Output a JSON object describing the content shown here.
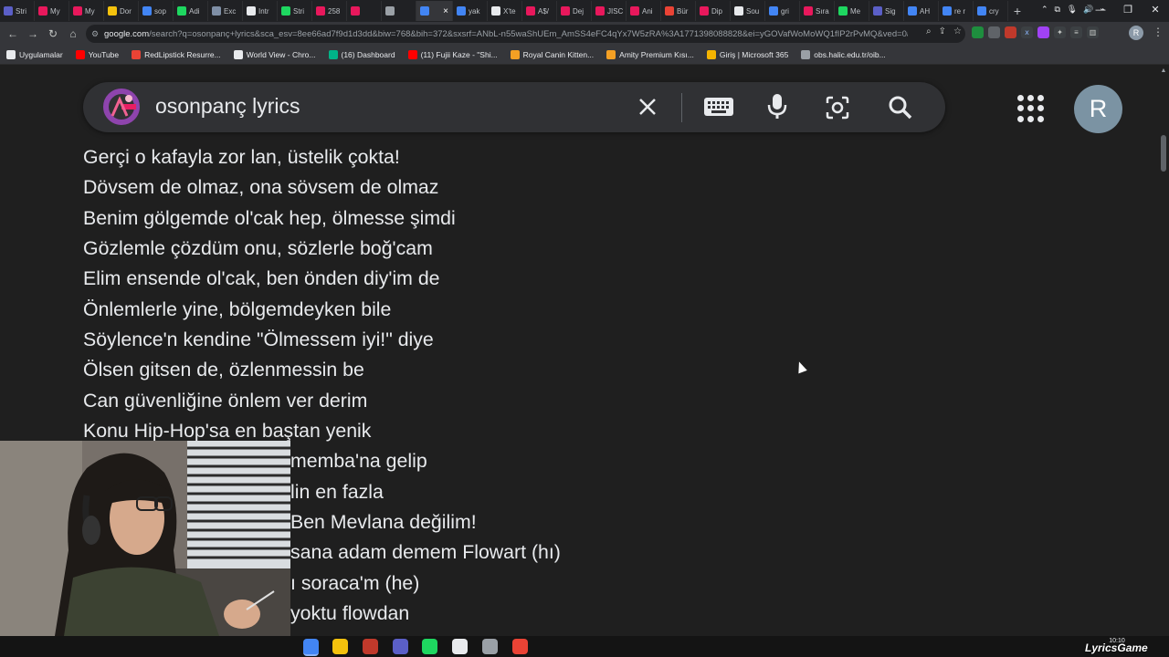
{
  "browser": {
    "tabs": [
      {
        "label": "Stri",
        "color": "#5b5fc7"
      },
      {
        "label": "My",
        "color": "#e8185c"
      },
      {
        "label": "My",
        "color": "#e8185c"
      },
      {
        "label": "Dor",
        "color": "#f4c20d"
      },
      {
        "label": "sop",
        "color": "#4285f4"
      },
      {
        "label": "Adi",
        "color": "#1ed760"
      },
      {
        "label": "Exc",
        "color": "#7f8fa6"
      },
      {
        "label": "Intr",
        "color": "#e8eaed"
      },
      {
        "label": "Stri",
        "color": "#1ed760"
      },
      {
        "label": "258",
        "color": "#e8185c"
      },
      {
        "label": "",
        "color": "#e8185c"
      },
      {
        "label": "",
        "color": "#9aa0a6"
      },
      {
        "label": "",
        "color": "#4285f4"
      },
      {
        "label": "yak",
        "color": "#4285f4"
      },
      {
        "label": "X'te",
        "color": "#e8eaed"
      },
      {
        "label": "A$/",
        "color": "#e8185c"
      },
      {
        "label": "Dej",
        "color": "#e8185c"
      },
      {
        "label": "JISC",
        "color": "#e8185c"
      },
      {
        "label": "Ani",
        "color": "#e8185c"
      },
      {
        "label": "Bür",
        "color": "#ea4335"
      },
      {
        "label": "Dip",
        "color": "#e8185c"
      },
      {
        "label": "Sou",
        "color": "#e8eaed"
      },
      {
        "label": "gri",
        "color": "#4285f4"
      },
      {
        "label": "Sıra",
        "color": "#e8185c"
      },
      {
        "label": "Me",
        "color": "#1ed760"
      },
      {
        "label": "Sig",
        "color": "#5b5fc7"
      },
      {
        "label": "AH",
        "color": "#4285f4"
      },
      {
        "label": "re r",
        "color": "#4285f4"
      },
      {
        "label": "cry",
        "color": "#4285f4"
      }
    ],
    "active_tab_index": 12,
    "new_tab": "+",
    "url_host": "google.com",
    "url_rest": "/search?q=osonpanç+lyrics&sca_esv=8ee66ad7f9d1d3dd&biw=768&bih=372&sxsrf=ANbL-n55waShUEm_AmSS4eFC4qYx7W5zRA%3A1771398088828&ei=yGOVafWoMoWQ1fIP2rPvMQ&ved=0ahU...",
    "bookmarks": [
      {
        "label": "Uygulamalar",
        "color": "#e8eaed"
      },
      {
        "label": "YouTube",
        "color": "#ff0000"
      },
      {
        "label": "RedLipstick Resurre...",
        "color": "#ea4335"
      },
      {
        "label": "World View - Chro...",
        "color": "#e8eaed"
      },
      {
        "label": "(16) Dashboard",
        "color": "#00b488"
      },
      {
        "label": "(11) Fujii Kaze - \"Shi...",
        "color": "#ff0000"
      },
      {
        "label": "Royal Canin Kitten...",
        "color": "#f4a024"
      },
      {
        "label": "Amity Premium Kısı...",
        "color": "#f4a024"
      },
      {
        "label": "Giriş | Microsoft 365",
        "color": "#f4b400"
      },
      {
        "label": "obs.halic.edu.tr/oib...",
        "color": "#9aa0a6"
      }
    ]
  },
  "search": {
    "query": "osonpanç lyrics",
    "avatar_letter": "R"
  },
  "lyrics": [
    "Gerçi o kafayla zor lan, üstelik çokta!",
    "Dövsem de olmaz, ona sövsem de olmaz",
    "Benim gölgemde ol'cak hep, ölmesse şimdi",
    "Gözlemle çözdüm onu, sözlerle boğ'cam",
    "Elim ensende ol'cak, ben önden diy'im de",
    "Önlemlerle yine, bölgemdeyken bile",
    "Söylence'n kendine \"Ölmessem iyi!\" diye",
    "Ölsen gitsen de, özlenmessin be",
    "Can güvenliğine önlem ver derim",
    "Konu Hip-Hop'sa en baştan yenik",
    "memba'na gelip",
    "lin en fazla",
    " Ben Mevlana değilim!",
    "sana adam demem Flowart (hı)",
    "ı soraca'm (he)",
    "yoktu flowdan"
  ],
  "taskbar": {
    "apps": [
      {
        "name": "chrome",
        "color": "#4285f4"
      },
      {
        "name": "files",
        "color": "#f4c20d"
      },
      {
        "name": "video-editor",
        "color": "#c0392b"
      },
      {
        "name": "obs",
        "color": "#5b5fc7"
      },
      {
        "name": "spotify",
        "color": "#1ed760"
      },
      {
        "name": "app-dark",
        "color": "#e8eaed"
      },
      {
        "name": "chrome-alt",
        "color": "#9aa0a6"
      },
      {
        "name": "chrome-2",
        "color": "#ea4335"
      }
    ],
    "clock_time": "10:10",
    "watermark": "LyricsGame"
  }
}
